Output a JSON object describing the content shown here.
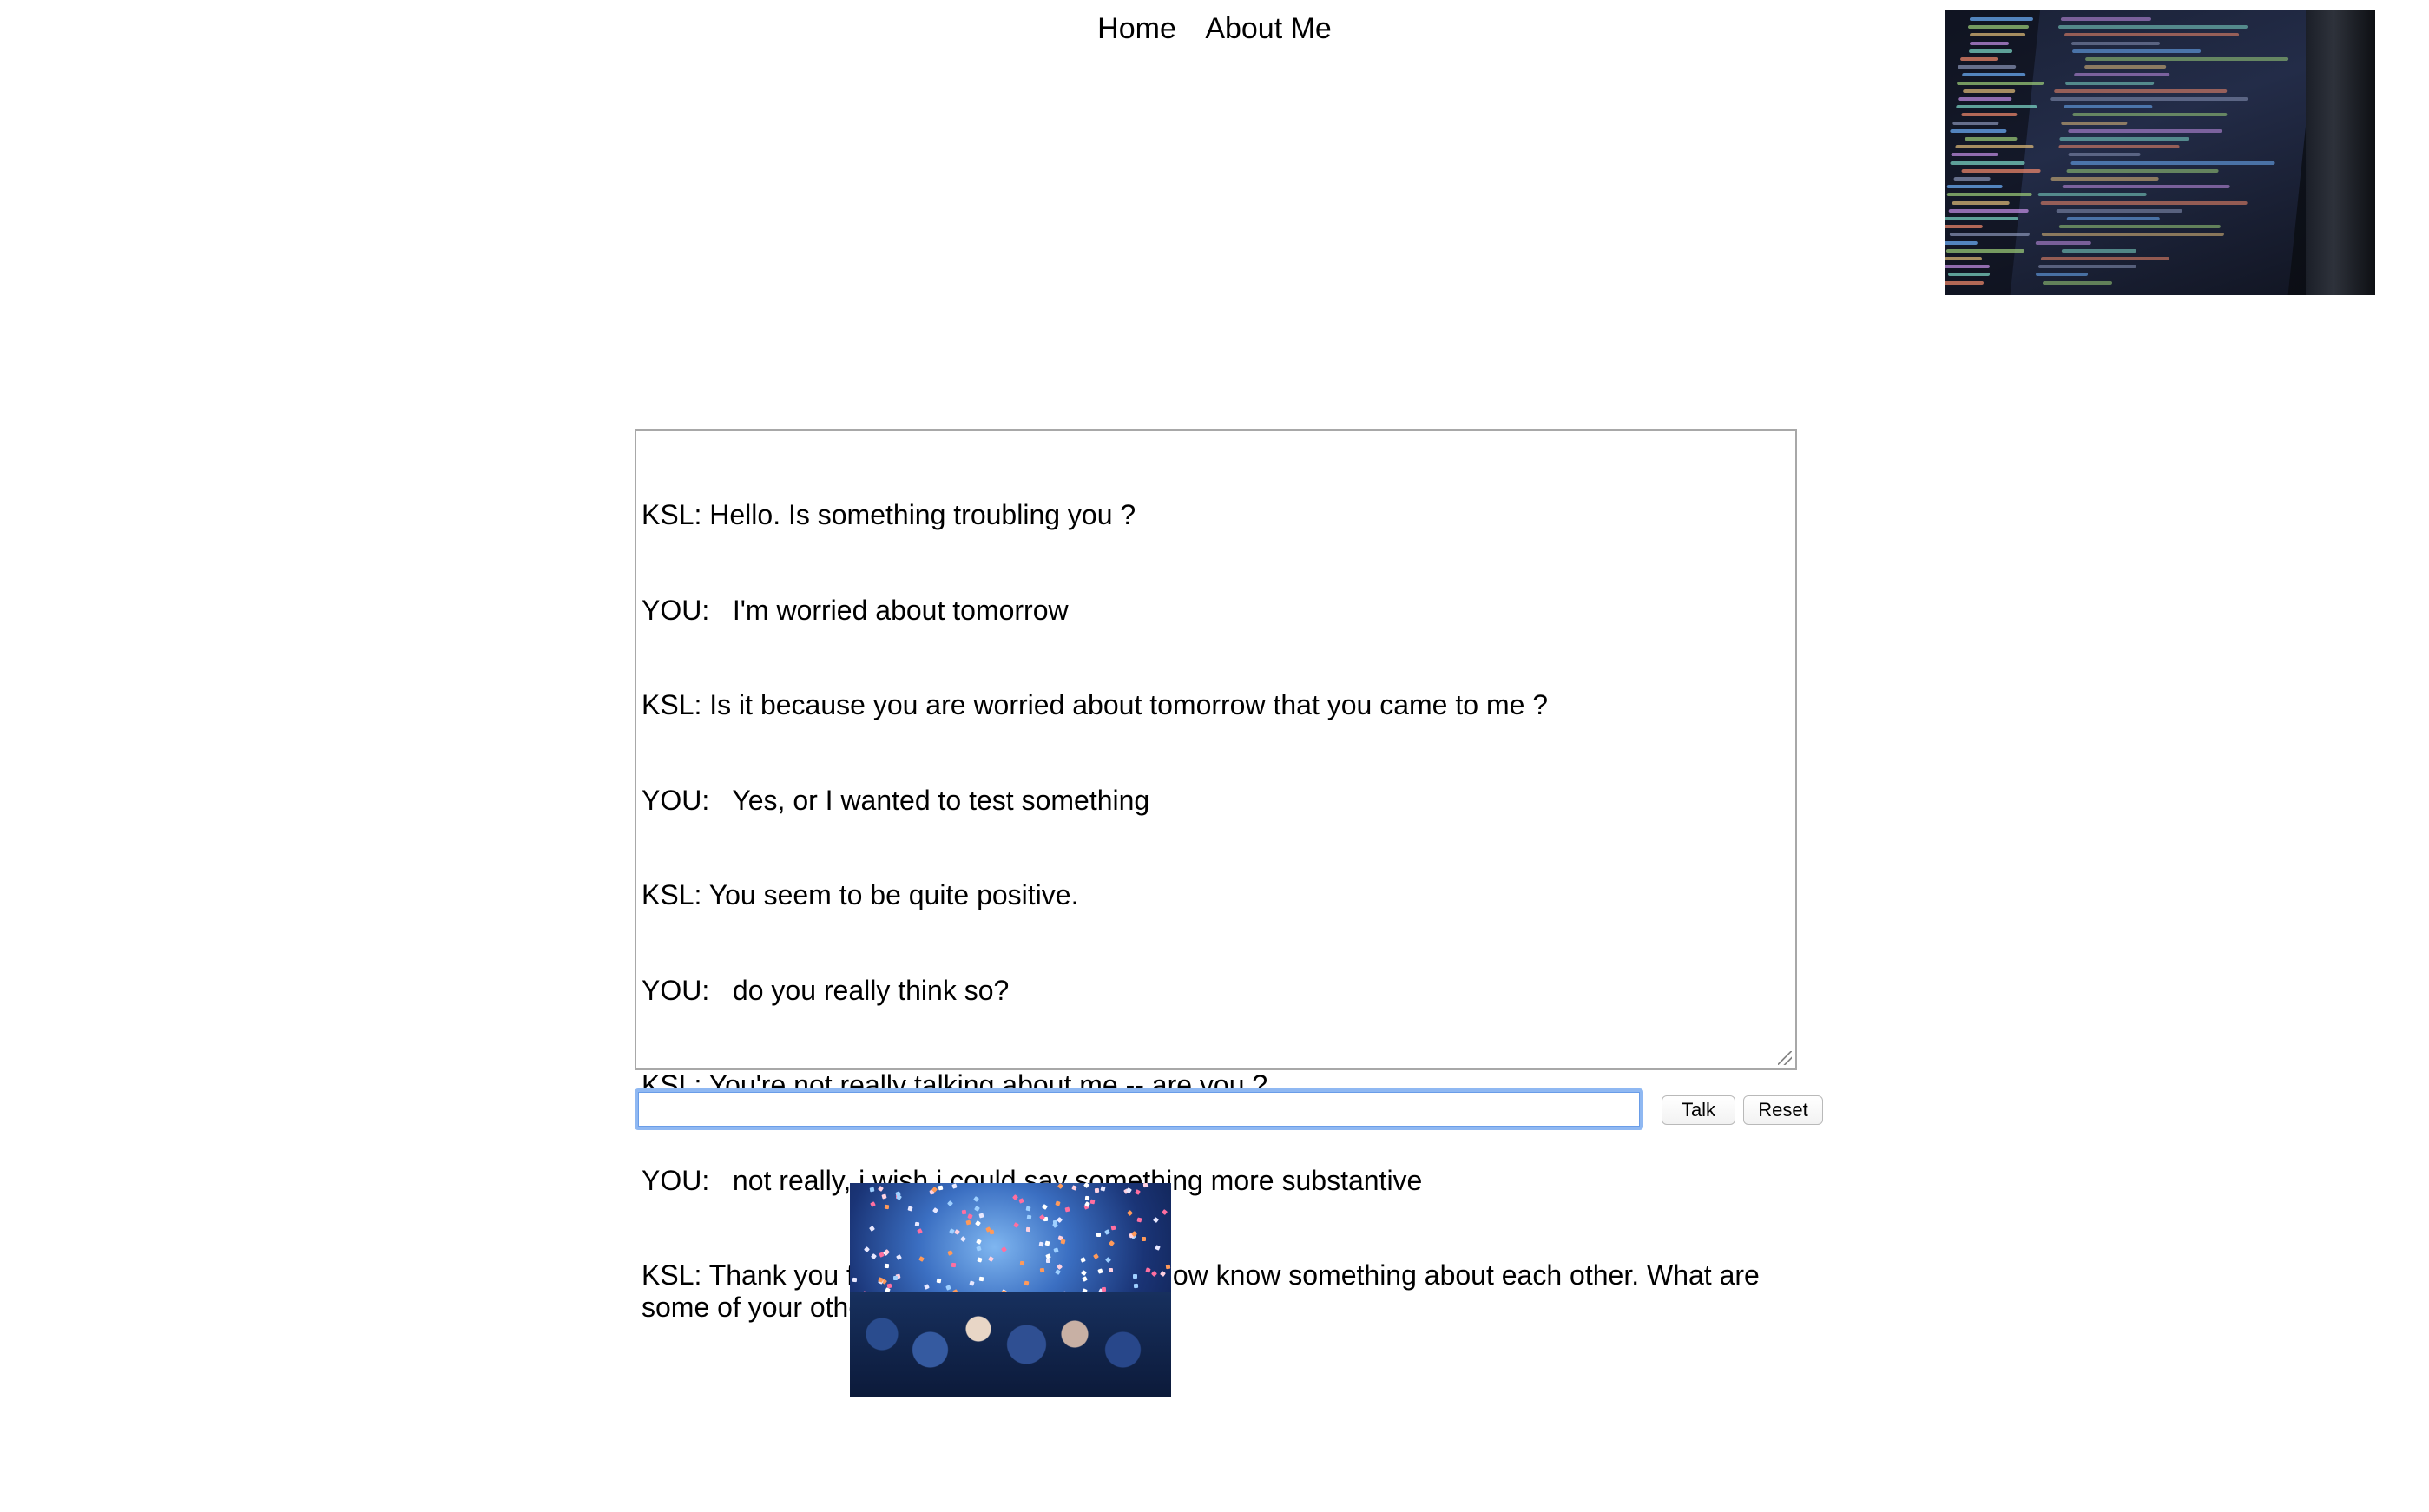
{
  "nav": {
    "items": [
      {
        "label": "Home"
      },
      {
        "label": "About Me"
      }
    ]
  },
  "chat": {
    "lines": [
      "KSL: Hello. Is something troubling you ?",
      "YOU:   I'm worried about tomorrow",
      "KSL: Is it because you are worried about tomorrow that you came to me ?",
      "YOU:   Yes, or I wanted to test something",
      "KSL: You seem to be quite positive.",
      "YOU:   do you really think so?",
      "KSL: You're not really talking about me -- are you ?",
      "YOU:   not really, i wish i could say something more substantive",
      "KSL: Thank you for your vulnerability. We now know something about each other. What are some of your other needs or wants?"
    ]
  },
  "input": {
    "value": "",
    "placeholder": ""
  },
  "buttons": {
    "talk_label": "Talk",
    "reset_label": "Reset"
  },
  "colors": {
    "input_focus": "#8fb8f2",
    "textarea_border": "#a8a8a8"
  },
  "images": {
    "top_right": "laptop-code-photo",
    "bottom": "party-crowd-photo"
  }
}
